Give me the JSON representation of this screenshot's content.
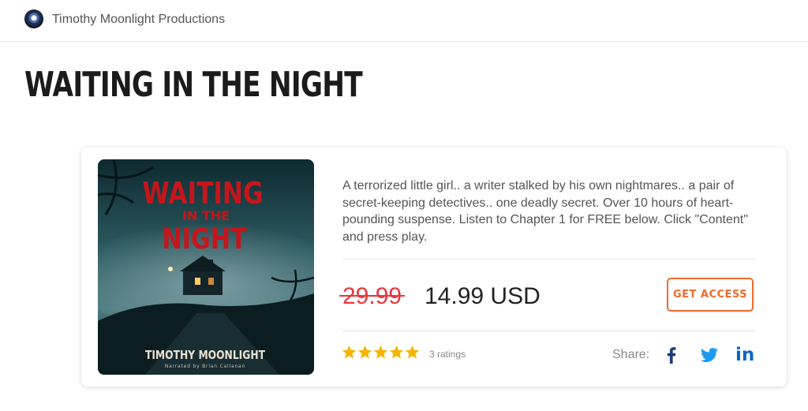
{
  "header": {
    "brand_name": "Timothy Moonlight Productions"
  },
  "product": {
    "title": "WAITING IN THE NIGHT",
    "cover": {
      "title_line1": "WAITING",
      "title_line2": "IN THE",
      "title_line3": "NIGHT",
      "author": "TIMOTHY MOONLIGHT",
      "narrator": "Narrated by Brian Callanan"
    },
    "description": "A terrorized little girl.. a writer stalked by his own nightmares.. a pair of secret-keeping detectives.. one deadly secret. Over 10 hours of heart-pounding suspense. Listen to Chapter 1 for FREE below. Click \"Content\" and press play.",
    "original_price": "29.99",
    "sale_price": "14.99 USD",
    "cta_label": "GET ACCESS",
    "rating_stars": 5,
    "rating_count": "3 ratings",
    "share_label": "Share:",
    "social_icons": [
      "facebook-icon",
      "twitter-icon",
      "linkedin-icon"
    ],
    "linkedin_glyph": "in"
  },
  "colors": {
    "accent": "#f06a2b",
    "old_price": "#e8373e",
    "star": "#f6b400",
    "facebook": "#1877f2",
    "twitter": "#1da1f2",
    "linkedin": "#0a66c2"
  }
}
